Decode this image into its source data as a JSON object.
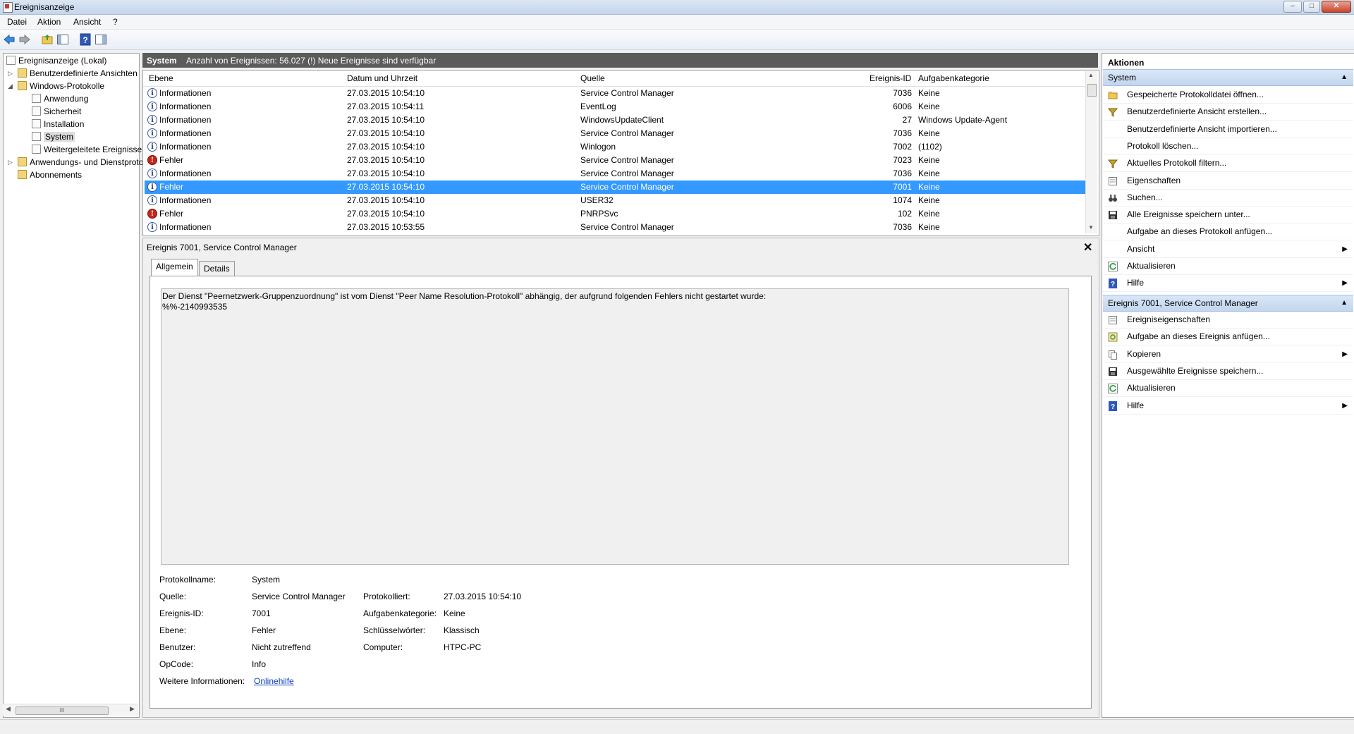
{
  "window": {
    "title": "Ereignisanzeige"
  },
  "menubar": {
    "items": [
      "Datei",
      "Aktion",
      "Ansicht",
      "?"
    ]
  },
  "tree": {
    "items": [
      {
        "label": "Ereignisanzeige (Lokal)"
      },
      {
        "label": "Benutzerdefinierte Ansichten"
      },
      {
        "label": "Windows-Protokolle"
      },
      {
        "label": "Anwendung"
      },
      {
        "label": "Sicherheit"
      },
      {
        "label": "Installation"
      },
      {
        "label": "System"
      },
      {
        "label": "Weitergeleitete Ereignisse"
      },
      {
        "label": "Anwendungs- und Dienstprotokolle"
      },
      {
        "label": "Abonnements"
      }
    ],
    "scroll_glyph": "III"
  },
  "log": {
    "name": "System",
    "summary": "Anzahl von Ereignissen: 56.027 (!) Neue Ereignisse sind verfügbar",
    "columns": [
      "Ebene",
      "Datum und Uhrzeit",
      "Quelle",
      "Ereignis-ID",
      "Aufgabenkategorie"
    ],
    "rows": [
      {
        "level": "Informationen",
        "type": "info",
        "date": "27.03.2015 10:54:10",
        "source": "Service Control Manager",
        "id": "7036",
        "category": "Keine"
      },
      {
        "level": "Informationen",
        "type": "info",
        "date": "27.03.2015 10:54:11",
        "source": "EventLog",
        "id": "6006",
        "category": "Keine"
      },
      {
        "level": "Informationen",
        "type": "info",
        "date": "27.03.2015 10:54:10",
        "source": "WindowsUpdateClient",
        "id": "27",
        "category": "Windows Update-Agent"
      },
      {
        "level": "Informationen",
        "type": "info",
        "date": "27.03.2015 10:54:10",
        "source": "Service Control Manager",
        "id": "7036",
        "category": "Keine"
      },
      {
        "level": "Informationen",
        "type": "info",
        "date": "27.03.2015 10:54:10",
        "source": "Winlogon",
        "id": "7002",
        "category": "(1102)"
      },
      {
        "level": "Fehler",
        "type": "err",
        "date": "27.03.2015 10:54:10",
        "source": "Service Control Manager",
        "id": "7023",
        "category": "Keine"
      },
      {
        "level": "Informationen",
        "type": "info",
        "date": "27.03.2015 10:54:10",
        "source": "Service Control Manager",
        "id": "7036",
        "category": "Keine"
      },
      {
        "level": "Fehler",
        "type": "info",
        "date": "27.03.2015 10:54:10",
        "source": "Service Control Manager",
        "id": "7001",
        "category": "Keine",
        "selected": true
      },
      {
        "level": "Informationen",
        "type": "info",
        "date": "27.03.2015 10:54:10",
        "source": "USER32",
        "id": "1074",
        "category": "Keine"
      },
      {
        "level": "Fehler",
        "type": "err",
        "date": "27.03.2015 10:54:10",
        "source": "PNRPSvc",
        "id": "102",
        "category": "Keine"
      },
      {
        "level": "Informationen",
        "type": "info",
        "date": "27.03.2015 10:53:55",
        "source": "Service Control Manager",
        "id": "7036",
        "category": "Keine"
      }
    ]
  },
  "detail": {
    "title": "Ereignis 7001, Service Control Manager",
    "tabs": [
      "Allgemein",
      "Details"
    ],
    "message_line1": "Der Dienst \"Peernetzwerk-Gruppenzuordnung\" ist vom Dienst \"Peer Name Resolution-Protokoll\" abhängig, der aufgrund folgenden Fehlers nicht gestartet wurde:",
    "message_line2": "%%-2140993535",
    "labels": {
      "protokollname": "Protokollname:",
      "quelle": "Quelle:",
      "ereignis_id": "Ereignis-ID:",
      "ebene": "Ebene:",
      "benutzer": "Benutzer:",
      "opcode": "OpCode:",
      "weitere": "Weitere Informationen:",
      "protokolliert": "Protokolliert:",
      "aufgabenkategorie": "Aufgabenkategorie:",
      "schluesselwoerter": "Schlüsselwörter:",
      "computer": "Computer:"
    },
    "values": {
      "protokollname": "System",
      "quelle": "Service Control Manager",
      "ereignis_id": "7001",
      "ebene": "Fehler",
      "benutzer": "Nicht zutreffend",
      "opcode": "Info",
      "weitere": "Onlinehilfe",
      "protokolliert": "27.03.2015 10:54:10",
      "aufgabenkategorie": "Keine",
      "schluesselwoerter": "Klassisch",
      "computer": "HTPC-PC"
    }
  },
  "actions": {
    "header": "Aktionen",
    "section1": "System",
    "items1": [
      {
        "label": "Gespeicherte Protokolldatei öffnen...",
        "icon": "open-folder-icon"
      },
      {
        "label": "Benutzerdefinierte Ansicht erstellen...",
        "icon": "filter-icon"
      },
      {
        "label": "Benutzerdefinierte Ansicht importieren...",
        "icon": ""
      },
      {
        "label": "Protokoll löschen...",
        "icon": ""
      },
      {
        "label": "Aktuelles Protokoll filtern...",
        "icon": "filter-icon"
      },
      {
        "label": "Eigenschaften",
        "icon": "properties-icon"
      },
      {
        "label": "Suchen...",
        "icon": "binoculars-icon"
      },
      {
        "label": "Alle Ereignisse speichern unter...",
        "icon": "save-icon"
      },
      {
        "label": "Aufgabe an dieses Protokoll anfügen...",
        "icon": ""
      },
      {
        "label": "Ansicht",
        "icon": "",
        "submenu": true
      },
      {
        "label": "Aktualisieren",
        "icon": "refresh-icon"
      },
      {
        "label": "Hilfe",
        "icon": "help-icon",
        "submenu": true
      }
    ],
    "section2": "Ereignis 7001, Service Control Manager",
    "items2": [
      {
        "label": "Ereigniseigenschaften",
        "icon": "properties-icon"
      },
      {
        "label": "Aufgabe an dieses Ereignis anfügen...",
        "icon": "task-icon"
      },
      {
        "label": "Kopieren",
        "icon": "copy-icon",
        "submenu": true
      },
      {
        "label": "Ausgewählte Ereignisse speichern...",
        "icon": "save-icon"
      },
      {
        "label": "Aktualisieren",
        "icon": "refresh-icon"
      },
      {
        "label": "Hilfe",
        "icon": "help-icon",
        "submenu": true
      }
    ]
  },
  "colors": {
    "selection": "#3399ff",
    "error": "#c8261d",
    "info": "#3d5a9e",
    "header_bar": "#5b5b5b"
  }
}
